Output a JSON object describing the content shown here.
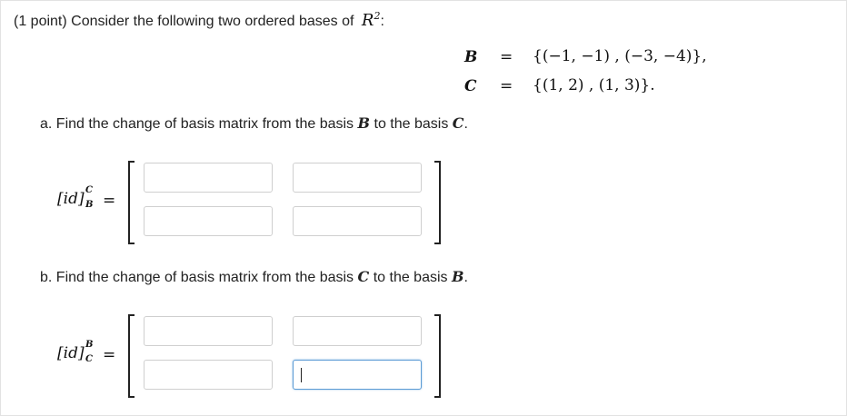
{
  "header": {
    "prefix": "(1 point) Consider the following two ordered bases of",
    "space_symbol": "R",
    "space_exponent": "2",
    "suffix": ":"
  },
  "bases": [
    {
      "symbol": "B",
      "equals": "=",
      "value": "{(−1, −1) , (−3, −4)},"
    },
    {
      "symbol": "C",
      "equals": "=",
      "value": "{(1, 2) , (1, 3)}."
    }
  ],
  "part_a": {
    "question": "a. Find the change of basis matrix from the basis",
    "from": "B",
    "middle": "to the basis",
    "to": "C",
    "end": ".",
    "lhs": "[id]",
    "lhs_sup": "C",
    "lhs_sub": "B",
    "equals": "=",
    "cells": [
      "",
      "",
      "",
      ""
    ]
  },
  "part_b": {
    "question": "b. Find the change of basis matrix from the basis",
    "from": "C",
    "middle": "to the basis",
    "to": "B",
    "end": ".",
    "lhs": "[id]",
    "lhs_sup": "B",
    "lhs_sub": "C",
    "equals": "=",
    "cells": [
      "",
      "",
      "",
      ""
    ]
  }
}
